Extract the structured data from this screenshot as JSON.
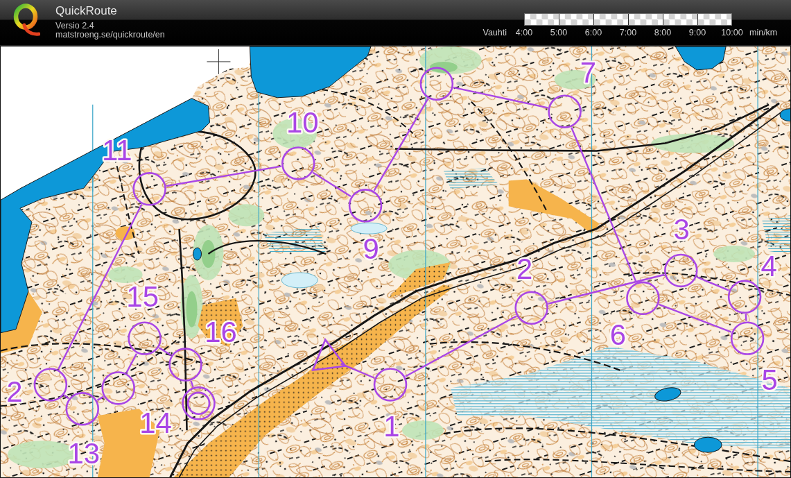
{
  "header": {
    "title": "QuickRoute",
    "version": "Versio 2.4",
    "url": "matstroeng.se/quickroute/en"
  },
  "pace_scale": {
    "label": "Vauhti",
    "ticks": [
      "4:00",
      "5:00",
      "6:00",
      "7:00",
      "8:00",
      "9:00",
      "10:00"
    ],
    "unit": "min/km"
  },
  "map": {
    "course": [
      {
        "kind": "start"
      },
      {
        "kind": "control",
        "label": "1"
      },
      {
        "kind": "control",
        "label": "2"
      },
      {
        "kind": "control",
        "label": "3"
      },
      {
        "kind": "control",
        "label": "4"
      },
      {
        "kind": "control",
        "label": "5"
      },
      {
        "kind": "control",
        "label": "6"
      },
      {
        "kind": "control",
        "label": "7"
      },
      {
        "kind": "control"
      },
      {
        "kind": "control",
        "label": "9"
      },
      {
        "kind": "control",
        "label": "10"
      },
      {
        "kind": "control",
        "label": "11"
      },
      {
        "kind": "control",
        "label": "2"
      },
      {
        "kind": "control",
        "label": "13"
      },
      {
        "kind": "control",
        "label": "14"
      },
      {
        "kind": "control",
        "label": "15"
      },
      {
        "kind": "control",
        "label": "16"
      },
      {
        "kind": "finish"
      }
    ]
  }
}
